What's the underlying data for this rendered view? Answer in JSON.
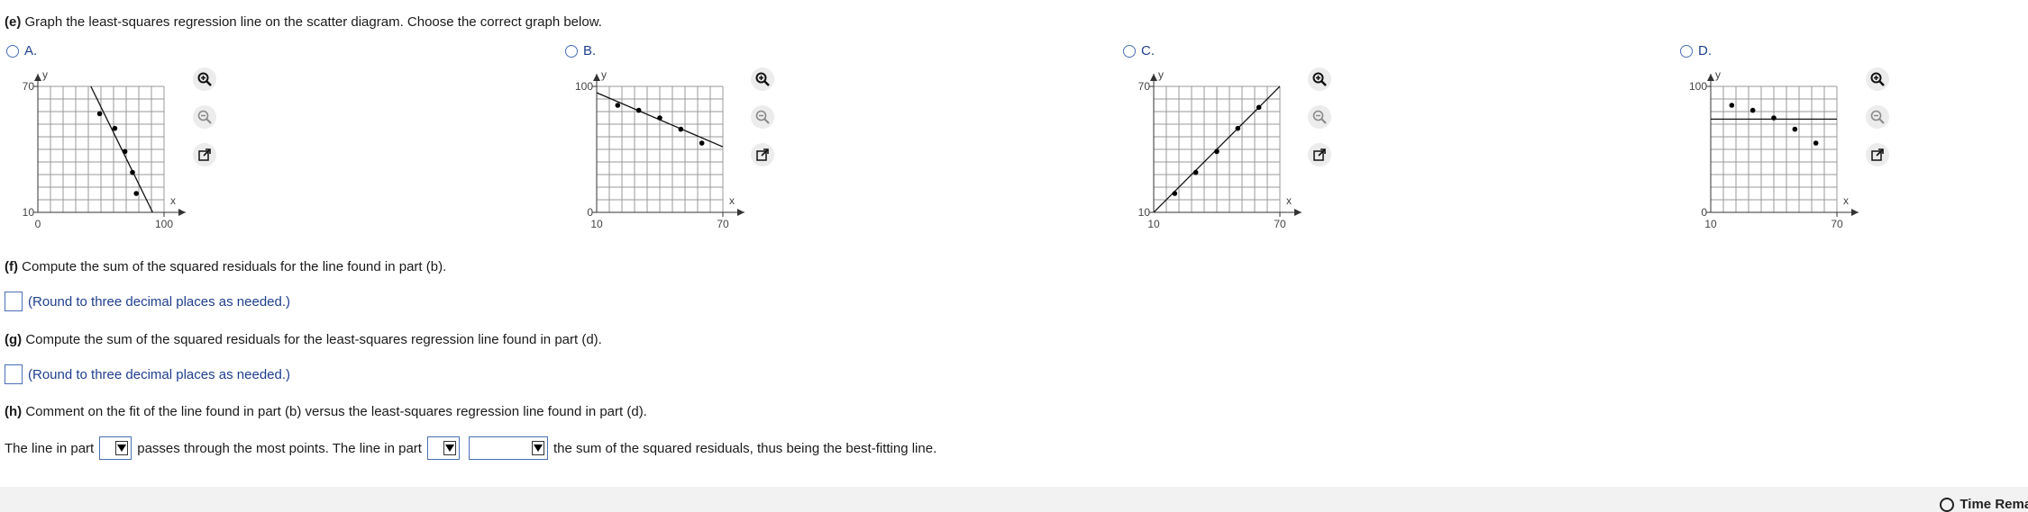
{
  "part_e": {
    "label": "(e)",
    "text": "Graph the least-squares regression line on the scatter diagram. Choose the correct graph below."
  },
  "options": [
    {
      "letter": "A.",
      "y_top": "70",
      "y_bottom": "10",
      "x_left": "0",
      "x_right": "100",
      "x_axis": "x",
      "y_axis": "y",
      "chart_data": {
        "type": "scatter",
        "xlim": [
          0,
          100
        ],
        "ylim": [
          10,
          70
        ],
        "grid": true,
        "points": [
          [
            49,
            57
          ],
          [
            61,
            50
          ],
          [
            69,
            39
          ],
          [
            75,
            29
          ],
          [
            78,
            19
          ]
        ],
        "line": [
          [
            42,
            70
          ],
          [
            91,
            10
          ]
        ]
      }
    },
    {
      "letter": "B.",
      "y_top": "100",
      "y_bottom": "0",
      "x_left": "10",
      "x_right": "70",
      "x_axis": "x",
      "y_axis": "y",
      "chart_data": {
        "type": "scatter",
        "xlim": [
          10,
          70
        ],
        "ylim": [
          0,
          100
        ],
        "grid": true,
        "points": [
          [
            20,
            85
          ],
          [
            30,
            81
          ],
          [
            40,
            75
          ],
          [
            50,
            66
          ],
          [
            60,
            55
          ]
        ],
        "line": [
          [
            10,
            95
          ],
          [
            70,
            52
          ]
        ]
      }
    },
    {
      "letter": "C.",
      "y_top": "70",
      "y_bottom": "10",
      "x_left": "10",
      "x_right": "70",
      "x_axis": "x",
      "y_axis": "y",
      "chart_data": {
        "type": "scatter",
        "xlim": [
          10,
          70
        ],
        "ylim": [
          10,
          70
        ],
        "grid": true,
        "points": [
          [
            20,
            19
          ],
          [
            30,
            29
          ],
          [
            40,
            39
          ],
          [
            50,
            50
          ],
          [
            60,
            60
          ]
        ],
        "line": [
          [
            10,
            10
          ],
          [
            70,
            70
          ]
        ]
      }
    },
    {
      "letter": "D.",
      "y_top": "100",
      "y_bottom": "0",
      "x_left": "10",
      "x_right": "70",
      "x_axis": "x",
      "y_axis": "y",
      "chart_data": {
        "type": "scatter",
        "xlim": [
          10,
          70
        ],
        "ylim": [
          0,
          100
        ],
        "grid": true,
        "points": [
          [
            20,
            85
          ],
          [
            30,
            81
          ],
          [
            40,
            75
          ],
          [
            50,
            66
          ],
          [
            60,
            55
          ]
        ],
        "line": [
          [
            10,
            74
          ],
          [
            70,
            74
          ]
        ]
      }
    }
  ],
  "part_f": {
    "label": "(f)",
    "text": "Compute the sum of the squared residuals for the line found in part (b).",
    "hint": "(Round to three decimal places as needed.)"
  },
  "part_g": {
    "label": "(g)",
    "text": "Compute the sum of the squared residuals for the least-squares regression line found in part (d).",
    "hint": "(Round to three decimal places as needed.)"
  },
  "part_h": {
    "label": "(h)",
    "text": "Comment on the fit of the line found in part (b) versus the least-squares regression line found in part (d).",
    "sentence_1": "The line in part",
    "sentence_2": "passes through the most points. The line in part",
    "sentence_3": "the sum of the squared residuals, thus being the best-fitting line."
  },
  "footer": {
    "timer_label": "Time Remaining"
  },
  "colors": {
    "link": "#1f3f8f",
    "border": "#4a6fb5",
    "grid": "#999999",
    "axis": "#333333"
  }
}
